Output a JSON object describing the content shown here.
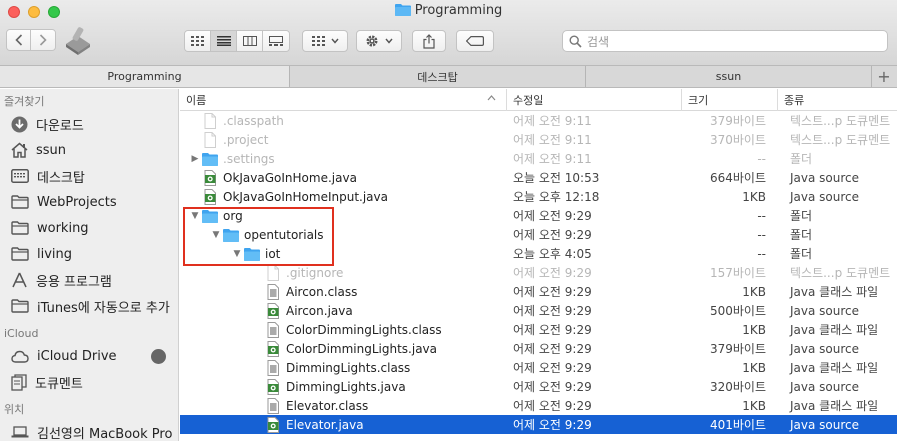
{
  "window": {
    "title": "Programming"
  },
  "search": {
    "placeholder": "검색"
  },
  "tabs": [
    {
      "label": "Programming",
      "active": true
    },
    {
      "label": "데스크탑",
      "active": false
    },
    {
      "label": "ssun",
      "active": false
    }
  ],
  "sidebar": {
    "favorites_heading": "즐겨찾기",
    "favorites": [
      {
        "label": "다운로드",
        "icon": "download-icon"
      },
      {
        "label": "ssun",
        "icon": "home-icon"
      },
      {
        "label": "데스크탑",
        "icon": "desktop-icon"
      },
      {
        "label": "WebProjects",
        "icon": "folder-icon"
      },
      {
        "label": "working",
        "icon": "folder-icon"
      },
      {
        "label": "living",
        "icon": "folder-icon"
      },
      {
        "label": "응용 프로그램",
        "icon": "applications-icon"
      },
      {
        "label": "iTunes에 자동으로 추가",
        "icon": "folder-icon"
      }
    ],
    "icloud_heading": "iCloud",
    "icloud": [
      {
        "label": "iCloud Drive",
        "icon": "cloud-icon"
      },
      {
        "label": "도큐멘트",
        "icon": "document-icon"
      }
    ],
    "locations_heading": "위치",
    "locations": [
      {
        "label": "김선영의 MacBook Pro",
        "icon": "laptop-icon"
      }
    ]
  },
  "columns": {
    "name": "이름",
    "date": "수정일",
    "size": "크기",
    "kind": "종류"
  },
  "files": [
    {
      "name": ".classpath",
      "date": "어제 오전 9:11",
      "size": "379바이트",
      "kind": "텍스트...p 도큐멘트",
      "indent": 0,
      "expand": "",
      "icon": "doc",
      "dim": true,
      "sel": false
    },
    {
      "name": ".project",
      "date": "어제 오전 9:11",
      "size": "370바이트",
      "kind": "텍스트...p 도큐멘트",
      "indent": 0,
      "expand": "",
      "icon": "doc",
      "dim": true,
      "sel": false
    },
    {
      "name": ".settings",
      "date": "어제 오전 9:11",
      "size": "--",
      "kind": "폴더",
      "indent": 0,
      "expand": "closed",
      "icon": "folder",
      "dim": true,
      "sel": false
    },
    {
      "name": "OkJavaGoInHome.java",
      "date": "오늘 오전 10:53",
      "size": "664바이트",
      "kind": "Java source",
      "indent": 0,
      "expand": "",
      "icon": "java",
      "dim": false,
      "sel": false
    },
    {
      "name": "OkJavaGoInHomeInput.java",
      "date": "오늘 오후 12:18",
      "size": "1KB",
      "kind": "Java source",
      "indent": 0,
      "expand": "",
      "icon": "java",
      "dim": false,
      "sel": false
    },
    {
      "name": "org",
      "date": "어제 오전 9:29",
      "size": "--",
      "kind": "폴더",
      "indent": 0,
      "expand": "open",
      "icon": "folder",
      "dim": false,
      "sel": false
    },
    {
      "name": "opentutorials",
      "date": "어제 오전 9:29",
      "size": "--",
      "kind": "폴더",
      "indent": 1,
      "expand": "open",
      "icon": "folder",
      "dim": false,
      "sel": false
    },
    {
      "name": "iot",
      "date": "오늘 오후 4:05",
      "size": "--",
      "kind": "폴더",
      "indent": 2,
      "expand": "open",
      "icon": "folder",
      "dim": false,
      "sel": false
    },
    {
      "name": ".gitignore",
      "date": "어제 오전 9:29",
      "size": "157바이트",
      "kind": "텍스트...p 도큐멘트",
      "indent": 3,
      "expand": "",
      "icon": "doc",
      "dim": true,
      "sel": false
    },
    {
      "name": "Aircon.class",
      "date": "어제 오전 9:29",
      "size": "1KB",
      "kind": "Java 클래스 파일",
      "indent": 3,
      "expand": "",
      "icon": "class",
      "dim": false,
      "sel": false
    },
    {
      "name": "Aircon.java",
      "date": "어제 오전 9:29",
      "size": "500바이트",
      "kind": "Java source",
      "indent": 3,
      "expand": "",
      "icon": "java",
      "dim": false,
      "sel": false
    },
    {
      "name": "ColorDimmingLights.class",
      "date": "어제 오전 9:29",
      "size": "1KB",
      "kind": "Java 클래스 파일",
      "indent": 3,
      "expand": "",
      "icon": "class",
      "dim": false,
      "sel": false
    },
    {
      "name": "ColorDimmingLights.java",
      "date": "어제 오전 9:29",
      "size": "379바이트",
      "kind": "Java source",
      "indent": 3,
      "expand": "",
      "icon": "java",
      "dim": false,
      "sel": false
    },
    {
      "name": "DimmingLights.class",
      "date": "어제 오전 9:29",
      "size": "1KB",
      "kind": "Java 클래스 파일",
      "indent": 3,
      "expand": "",
      "icon": "class",
      "dim": false,
      "sel": false
    },
    {
      "name": "DimmingLights.java",
      "date": "어제 오전 9:29",
      "size": "320바이트",
      "kind": "Java source",
      "indent": 3,
      "expand": "",
      "icon": "java",
      "dim": false,
      "sel": false
    },
    {
      "name": "Elevator.class",
      "date": "어제 오전 9:29",
      "size": "1KB",
      "kind": "Java 클래스 파일",
      "indent": 3,
      "expand": "",
      "icon": "class",
      "dim": false,
      "sel": false
    },
    {
      "name": "Elevator.java",
      "date": "어제 오전 9:29",
      "size": "401바이트",
      "kind": "Java source",
      "indent": 3,
      "expand": "",
      "icon": "java",
      "dim": false,
      "sel": true
    }
  ]
}
